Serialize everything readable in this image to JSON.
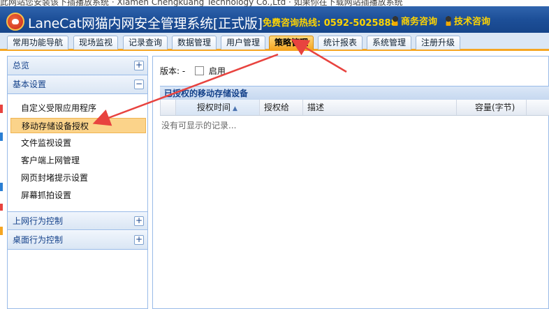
{
  "notice": {
    "text": "此网站您安装该下插播放系统 · Xiamen Chengkuang Technology Co.,Ltd · 如果你在下载网站插播放系统"
  },
  "header": {
    "brand": "LaneCat网猫内网安全管理系统[正式版]",
    "hotline": "免费咨询热线: 0592-5025888",
    "business_consult": "商务咨询",
    "tech_consult": "技术咨询"
  },
  "tabs": [
    {
      "label": "常用功能导航"
    },
    {
      "label": "现场监视"
    },
    {
      "label": "记录查询"
    },
    {
      "label": "数据管理"
    },
    {
      "label": "用户管理"
    },
    {
      "label": "策略管理",
      "active": true
    },
    {
      "label": "统计报表"
    },
    {
      "label": "系统管理"
    },
    {
      "label": "注册升级"
    }
  ],
  "sidebar": {
    "sections": [
      {
        "label": "总览",
        "toggle": "+"
      },
      {
        "label": "基本设置",
        "toggle": "−"
      },
      {
        "label": "上网行为控制",
        "toggle": "+"
      },
      {
        "label": "桌面行为控制",
        "toggle": "+"
      }
    ],
    "items": [
      {
        "label": "自定义受限应用程序"
      },
      {
        "label": "移动存储设备授权",
        "selected": true
      },
      {
        "label": "文件监视设置"
      },
      {
        "label": "客户端上网管理"
      },
      {
        "label": "网页封堵提示设置"
      },
      {
        "label": "屏幕抓拍设置"
      }
    ]
  },
  "main": {
    "version_label": "版本: -",
    "enable_label": "启用",
    "grid_title": "已授权的移动存储设备",
    "columns": [
      "授权时间",
      "授权给",
      "描述",
      "容量(字节)"
    ],
    "empty_text": "没有可显示的记录..."
  },
  "colors": {
    "header": "#1d4f98",
    "accent": "#f5a623",
    "arrow": "#e8433f",
    "link": "#15428b"
  }
}
